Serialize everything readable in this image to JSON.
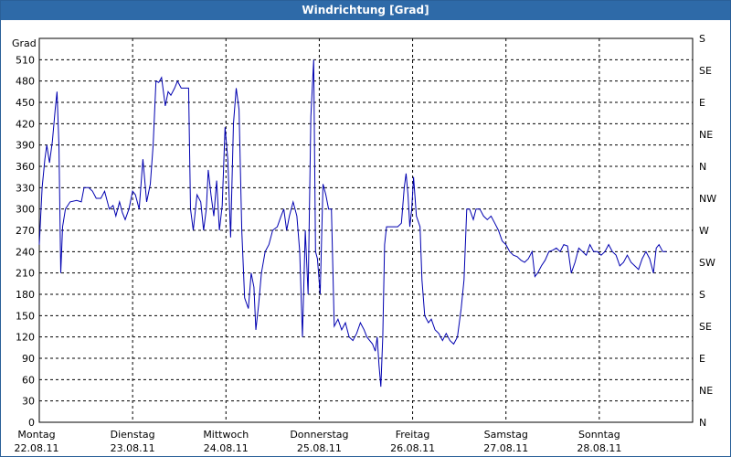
{
  "window": {
    "title": "Windrichtung [Grad]"
  },
  "chart_data": {
    "type": "line",
    "title": "Windrichtung [Grad]",
    "ylabel": "Grad",
    "ylim": [
      0,
      540
    ],
    "y_ticks": [
      0,
      30,
      60,
      90,
      120,
      150,
      180,
      210,
      240,
      270,
      300,
      330,
      360,
      390,
      420,
      450,
      480,
      510
    ],
    "y2_ticks": [
      "N",
      "NE",
      "E",
      "SE",
      "S",
      "SW",
      "W",
      "NW",
      "N",
      "NE",
      "E",
      "SE",
      "S"
    ],
    "x_unit": "days",
    "xlim": [
      0,
      7
    ],
    "x_ticks": [
      {
        "day": "Montag",
        "date": "22.08.11"
      },
      {
        "day": "Dienstag",
        "date": "23.08.11"
      },
      {
        "day": "Mittwoch",
        "date": "24.08.11"
      },
      {
        "day": "Donnerstag",
        "date": "25.08.11"
      },
      {
        "day": "Freitag",
        "date": "26.08.11"
      },
      {
        "day": "Samstag",
        "date": "27.08.11"
      },
      {
        "day": "Sonntag",
        "date": "28.08.11"
      }
    ],
    "grid": true,
    "series": [
      {
        "color": "#0000b0",
        "points": [
          [
            0.0,
            250
          ],
          [
            0.03,
            330
          ],
          [
            0.06,
            370
          ],
          [
            0.08,
            390
          ],
          [
            0.11,
            365
          ],
          [
            0.14,
            395
          ],
          [
            0.17,
            440
          ],
          [
            0.19,
            465
          ],
          [
            0.21,
            390
          ],
          [
            0.23,
            210
          ],
          [
            0.25,
            275
          ],
          [
            0.28,
            300
          ],
          [
            0.33,
            310
          ],
          [
            0.4,
            312
          ],
          [
            0.45,
            310
          ],
          [
            0.48,
            330
          ],
          [
            0.53,
            330
          ],
          [
            0.57,
            325
          ],
          [
            0.61,
            315
          ],
          [
            0.66,
            315
          ],
          [
            0.7,
            325
          ],
          [
            0.75,
            300
          ],
          [
            0.79,
            305
          ],
          [
            0.82,
            290
          ],
          [
            0.86,
            310
          ],
          [
            0.89,
            295
          ],
          [
            0.92,
            285
          ],
          [
            0.96,
            300
          ],
          [
            1.0,
            325
          ],
          [
            1.03,
            320
          ],
          [
            1.07,
            300
          ],
          [
            1.11,
            370
          ],
          [
            1.15,
            310
          ],
          [
            1.19,
            335
          ],
          [
            1.22,
            390
          ],
          [
            1.25,
            480
          ],
          [
            1.28,
            478
          ],
          [
            1.31,
            485
          ],
          [
            1.35,
            445
          ],
          [
            1.38,
            465
          ],
          [
            1.41,
            460
          ],
          [
            1.45,
            470
          ],
          [
            1.48,
            480
          ],
          [
            1.52,
            470
          ],
          [
            1.55,
            470
          ],
          [
            1.6,
            470
          ],
          [
            1.62,
            300
          ],
          [
            1.65,
            270
          ],
          [
            1.69,
            320
          ],
          [
            1.73,
            310
          ],
          [
            1.76,
            270
          ],
          [
            1.79,
            300
          ],
          [
            1.81,
            355
          ],
          [
            1.84,
            320
          ],
          [
            1.87,
            290
          ],
          [
            1.9,
            340
          ],
          [
            1.93,
            270
          ],
          [
            1.96,
            305
          ],
          [
            1.99,
            415
          ],
          [
            2.02,
            370
          ],
          [
            2.05,
            260
          ],
          [
            2.08,
            420
          ],
          [
            2.11,
            470
          ],
          [
            2.14,
            440
          ],
          [
            2.17,
            270
          ],
          [
            2.2,
            175
          ],
          [
            2.24,
            160
          ],
          [
            2.27,
            210
          ],
          [
            2.3,
            190
          ],
          [
            2.32,
            130
          ],
          [
            2.35,
            165
          ],
          [
            2.38,
            210
          ],
          [
            2.42,
            240
          ],
          [
            2.46,
            250
          ],
          [
            2.5,
            270
          ],
          [
            2.55,
            275
          ],
          [
            2.59,
            290
          ],
          [
            2.62,
            300
          ],
          [
            2.65,
            270
          ],
          [
            2.68,
            290
          ],
          [
            2.72,
            310
          ],
          [
            2.76,
            290
          ],
          [
            2.79,
            240
          ],
          [
            2.82,
            120
          ],
          [
            2.85,
            270
          ],
          [
            2.88,
            180
          ],
          [
            2.91,
            430
          ],
          [
            2.94,
            510
          ],
          [
            2.96,
            240
          ],
          [
            2.98,
            230
          ],
          [
            3.01,
            180
          ],
          [
            3.04,
            335
          ],
          [
            3.07,
            320
          ],
          [
            3.1,
            300
          ],
          [
            3.13,
            300
          ],
          [
            3.16,
            135
          ],
          [
            3.2,
            145
          ],
          [
            3.24,
            130
          ],
          [
            3.28,
            140
          ],
          [
            3.32,
            120
          ],
          [
            3.36,
            115
          ],
          [
            3.4,
            125
          ],
          [
            3.44,
            140
          ],
          [
            3.48,
            130
          ],
          [
            3.51,
            120
          ],
          [
            3.54,
            115
          ],
          [
            3.57,
            110
          ],
          [
            3.6,
            100
          ],
          [
            3.62,
            120
          ],
          [
            3.64,
            80
          ],
          [
            3.66,
            50
          ],
          [
            3.68,
            120
          ],
          [
            3.7,
            250
          ],
          [
            3.72,
            275
          ],
          [
            3.76,
            275
          ],
          [
            3.8,
            275
          ],
          [
            3.84,
            275
          ],
          [
            3.88,
            280
          ],
          [
            3.91,
            330
          ],
          [
            3.93,
            350
          ],
          [
            3.95,
            320
          ],
          [
            3.97,
            275
          ],
          [
            3.99,
            300
          ],
          [
            4.01,
            345
          ],
          [
            4.04,
            290
          ],
          [
            4.08,
            275
          ],
          [
            4.1,
            200
          ],
          [
            4.13,
            150
          ],
          [
            4.17,
            140
          ],
          [
            4.2,
            145
          ],
          [
            4.24,
            130
          ],
          [
            4.28,
            125
          ],
          [
            4.32,
            115
          ],
          [
            4.36,
            125
          ],
          [
            4.4,
            115
          ],
          [
            4.44,
            110
          ],
          [
            4.48,
            120
          ],
          [
            4.52,
            160
          ],
          [
            4.55,
            200
          ],
          [
            4.58,
            300
          ],
          [
            4.61,
            300
          ],
          [
            4.65,
            285
          ],
          [
            4.68,
            300
          ],
          [
            4.72,
            300
          ],
          [
            4.76,
            290
          ],
          [
            4.8,
            285
          ],
          [
            4.84,
            290
          ],
          [
            4.88,
            280
          ],
          [
            4.92,
            270
          ],
          [
            4.96,
            255
          ],
          [
            5.0,
            250
          ],
          [
            5.04,
            240
          ],
          [
            5.08,
            235
          ],
          [
            5.12,
            233
          ],
          [
            5.16,
            228
          ],
          [
            5.2,
            225
          ],
          [
            5.24,
            230
          ],
          [
            5.28,
            240
          ],
          [
            5.31,
            205
          ],
          [
            5.34,
            210
          ],
          [
            5.38,
            220
          ],
          [
            5.42,
            228
          ],
          [
            5.46,
            240
          ],
          [
            5.5,
            242
          ],
          [
            5.54,
            245
          ],
          [
            5.58,
            240
          ],
          [
            5.62,
            250
          ],
          [
            5.66,
            248
          ],
          [
            5.7,
            210
          ],
          [
            5.74,
            225
          ],
          [
            5.78,
            245
          ],
          [
            5.82,
            240
          ],
          [
            5.86,
            235
          ],
          [
            5.9,
            250
          ],
          [
            5.94,
            240
          ],
          [
            5.98,
            240
          ],
          [
            6.02,
            235
          ],
          [
            6.06,
            240
          ],
          [
            6.1,
            250
          ],
          [
            6.14,
            240
          ],
          [
            6.18,
            235
          ],
          [
            6.22,
            220
          ],
          [
            6.26,
            225
          ],
          [
            6.3,
            235
          ],
          [
            6.34,
            225
          ],
          [
            6.38,
            220
          ],
          [
            6.42,
            215
          ],
          [
            6.46,
            230
          ],
          [
            6.5,
            240
          ],
          [
            6.54,
            230
          ],
          [
            6.58,
            210
          ],
          [
            6.61,
            245
          ],
          [
            6.64,
            250
          ],
          [
            6.68,
            240
          ],
          [
            6.72,
            240
          ]
        ]
      }
    ]
  }
}
